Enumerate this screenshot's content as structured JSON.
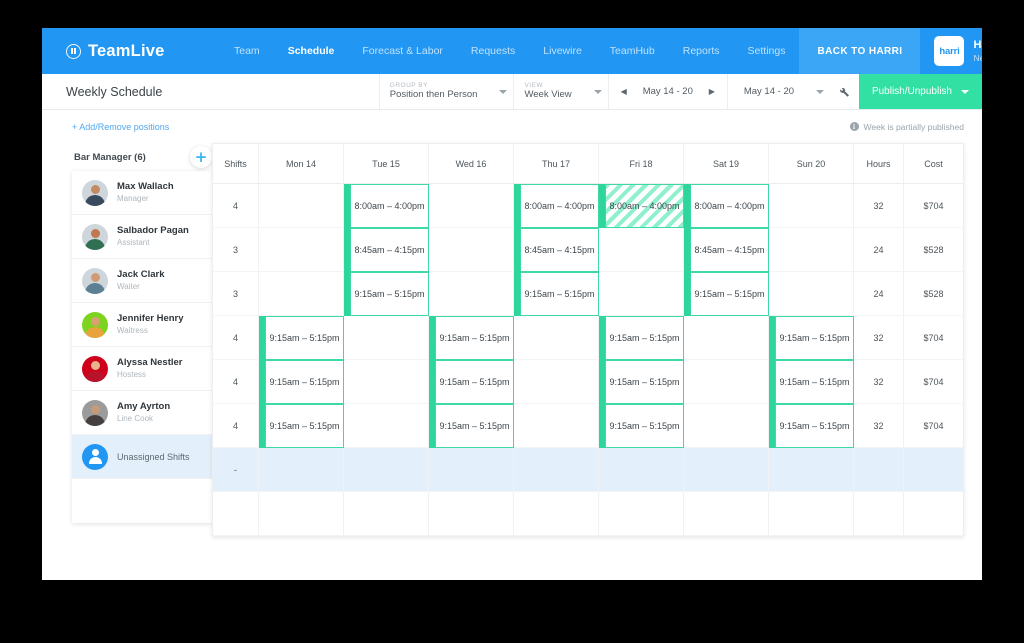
{
  "brand": {
    "name": "TeamLive",
    "mark": "equalizer-icon"
  },
  "nav": {
    "links": [
      {
        "label": "Team",
        "active": false
      },
      {
        "label": "Schedule",
        "active": true
      },
      {
        "label": "Forecast & Labor",
        "active": false
      },
      {
        "label": "Requests",
        "active": false
      },
      {
        "label": "Livewire",
        "active": false
      },
      {
        "label": "TeamHub",
        "active": false
      },
      {
        "label": "Reports",
        "active": false
      },
      {
        "label": "Settings",
        "active": false
      }
    ],
    "back_button": "BACK TO HARRI",
    "account": {
      "logo_text": "harri",
      "name": "Harri Bar",
      "location": "New York"
    }
  },
  "toolbar": {
    "page_title": "Weekly Schedule",
    "group_by": {
      "label": "GROUP BY",
      "value": "Position then Person"
    },
    "view": {
      "label": "VIEW",
      "value": "Week View"
    },
    "date_range_primary": "May 14 - 20",
    "date_range_secondary": "May 14 - 20",
    "prev_arrow": "◀",
    "next_arrow": "▶",
    "tool_icon": "wrench-icon",
    "publish_label": "Publish/Unpublish"
  },
  "subbar": {
    "add_remove_positions": "+ Add/Remove positions",
    "publish_status": "Week is partially published"
  },
  "schedule": {
    "group_title": "Bar Manager (6)",
    "add_position_icon": "plus-icon",
    "columns": [
      "Shifts",
      "Mon 14",
      "Tue 15",
      "Wed 16",
      "Thu 17",
      "Fri 18",
      "Sat 19",
      "Sun 20",
      "Hours",
      "Cost"
    ],
    "people": [
      {
        "name": "Max Wallach",
        "role": "Manager",
        "shifts": "4",
        "hours": "32",
        "cost": "$704",
        "cells": [
          "",
          "8:00am – 4:00pm",
          "",
          "8:00am – 4:00pm",
          "8:00am – 4:00pm",
          "8:00am – 4:00pm",
          ""
        ]
      },
      {
        "name": "Salbador Pagan",
        "role": "Assistant",
        "shifts": "3",
        "hours": "24",
        "cost": "$528",
        "cells": [
          "",
          "8:45am – 4:15pm",
          "",
          "8:45am – 4:15pm",
          "",
          "8:45am – 4:15pm",
          ""
        ]
      },
      {
        "name": "Jack Clark",
        "role": "Waiter",
        "shifts": "3",
        "hours": "24",
        "cost": "$528",
        "cells": [
          "",
          "9:15am – 5:15pm",
          "",
          "9:15am – 5:15pm",
          "",
          "9:15am – 5:15pm",
          ""
        ]
      },
      {
        "name": "Jennifer Henry",
        "role": "Waitress",
        "shifts": "4",
        "hours": "32",
        "cost": "$704",
        "cells": [
          "9:15am – 5:15pm",
          "",
          "9:15am – 5:15pm",
          "",
          "9:15am – 5:15pm",
          "",
          "9:15am – 5:15pm"
        ]
      },
      {
        "name": "Alyssa Nestler",
        "role": "Hostess",
        "shifts": "4",
        "hours": "32",
        "cost": "$704",
        "cells": [
          "9:15am – 5:15pm",
          "",
          "9:15am – 5:15pm",
          "",
          "9:15am – 5:15pm",
          "",
          "9:15am – 5:15pm"
        ]
      },
      {
        "name": "Amy Ayrton",
        "role": "Line Cook",
        "shifts": "4",
        "hours": "32",
        "cost": "$704",
        "cells": [
          "9:15am – 5:15pm",
          "",
          "9:15am – 5:15pm",
          "",
          "9:15am – 5:15pm",
          "",
          "9:15am – 5:15pm"
        ]
      }
    ],
    "unassigned": {
      "label": "Unassigned Shifts",
      "icon": "person-icon",
      "shifts": "-"
    },
    "unpublished_cell": {
      "row": 0,
      "day": "Fri 18",
      "value": "8:00am – 4:00pm"
    }
  },
  "colors": {
    "brand_blue": "#2196f3",
    "nav_blue_dark": "#3ba6f5",
    "accent_green": "#2ed69b",
    "shift_border": "#3fd9a4",
    "link_blue": "#52a7ef",
    "unassigned_row": "#e3f0fb"
  }
}
